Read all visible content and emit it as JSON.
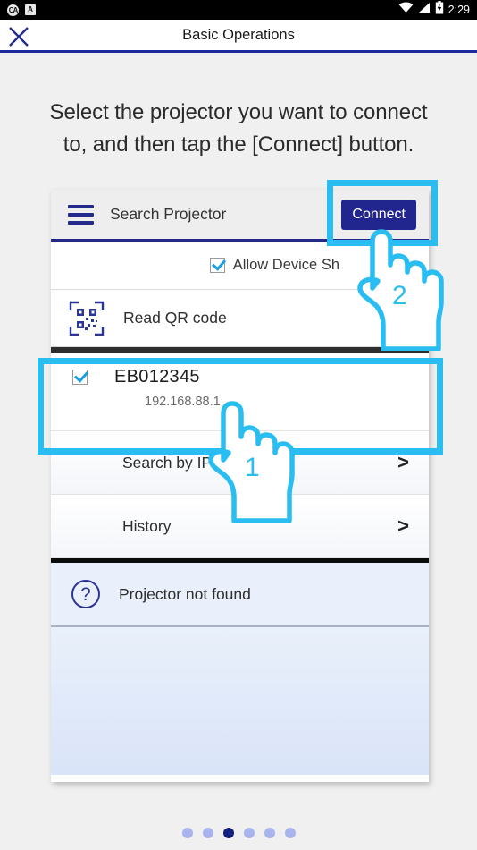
{
  "statusbar": {
    "left_icons": [
      {
        "name": "app-badge-ca-icon",
        "glyph": "CA"
      },
      {
        "name": "app-badge-a-icon",
        "glyph": "A"
      }
    ],
    "wifi_icon": "wifi-icon",
    "signal_icon": "cellular-signal-icon",
    "battery_icon": "battery-charging-icon",
    "time": "2:29"
  },
  "titlebar": {
    "close_icon": "close-x-icon",
    "title": "Basic Operations"
  },
  "instruction": {
    "line1": "Select the projector you want to connect",
    "line2": "to, and then tap the [Connect] button."
  },
  "app": {
    "menu_icon": "hamburger-menu-icon",
    "title": "Search Projector",
    "connect_label": "Connect",
    "allow_device_label": "Allow Device Sh",
    "qr_icon": "qr-code-icon",
    "qr_label": "Read QR code",
    "projector": {
      "name": "EB012345",
      "ip": "192.168.88.1",
      "checked": true
    },
    "nav_items": [
      {
        "label": "Search by IP Address",
        "chevron": ">"
      },
      {
        "label": "History",
        "chevron": ">"
      }
    ],
    "help_icon": "question-mark-circle-icon",
    "help_label": "Projector not found"
  },
  "annotations": {
    "step_one": "1",
    "step_two": "2",
    "highlight_color": "#29bdf2",
    "hand_icon": "pointing-hand-cursor-icon"
  },
  "pagination": {
    "total": 6,
    "active_index": 2
  },
  "colors": {
    "brand_navy": "#21268f",
    "accent_cyan": "#29bdf2",
    "page_bg": "#f0f0f0"
  }
}
